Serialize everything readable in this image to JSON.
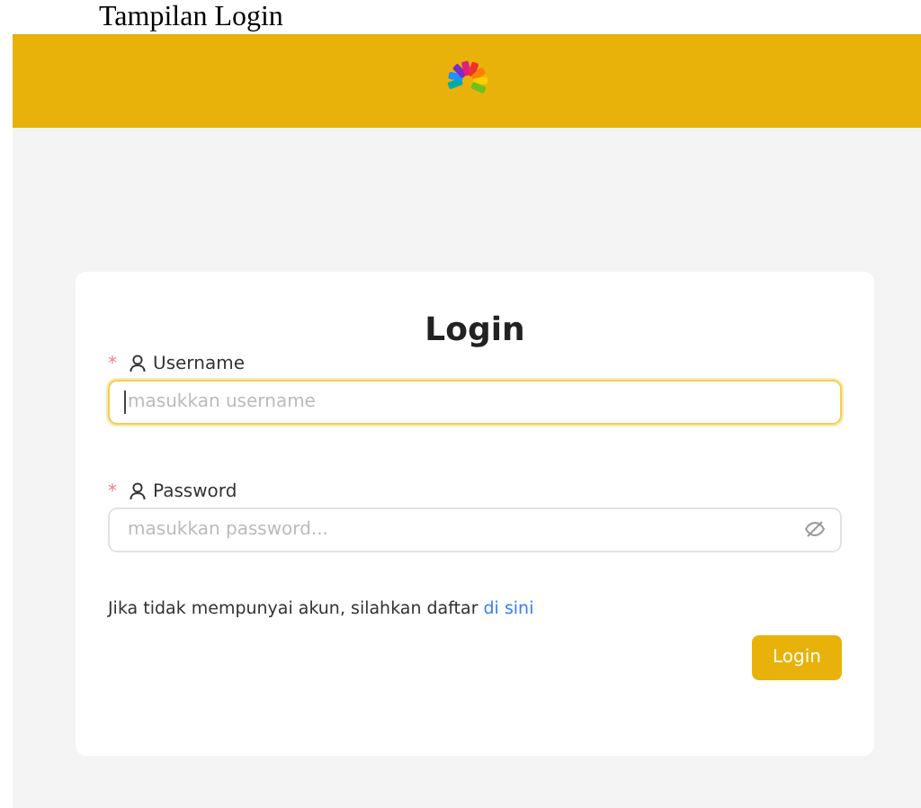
{
  "caption": "Tampilan Login",
  "form": {
    "title": "Login",
    "fields": [
      {
        "required_mark": "*",
        "label": "Username",
        "placeholder": "masukkan username",
        "focused": true,
        "kind": "text"
      },
      {
        "required_mark": "*",
        "label": "Password",
        "placeholder": "masukkan password...",
        "focused": false,
        "kind": "password"
      }
    ],
    "register_text": "Jika tidak mempunyai akun, silahkan daftar",
    "register_link": "di sini",
    "submit": "Login"
  }
}
